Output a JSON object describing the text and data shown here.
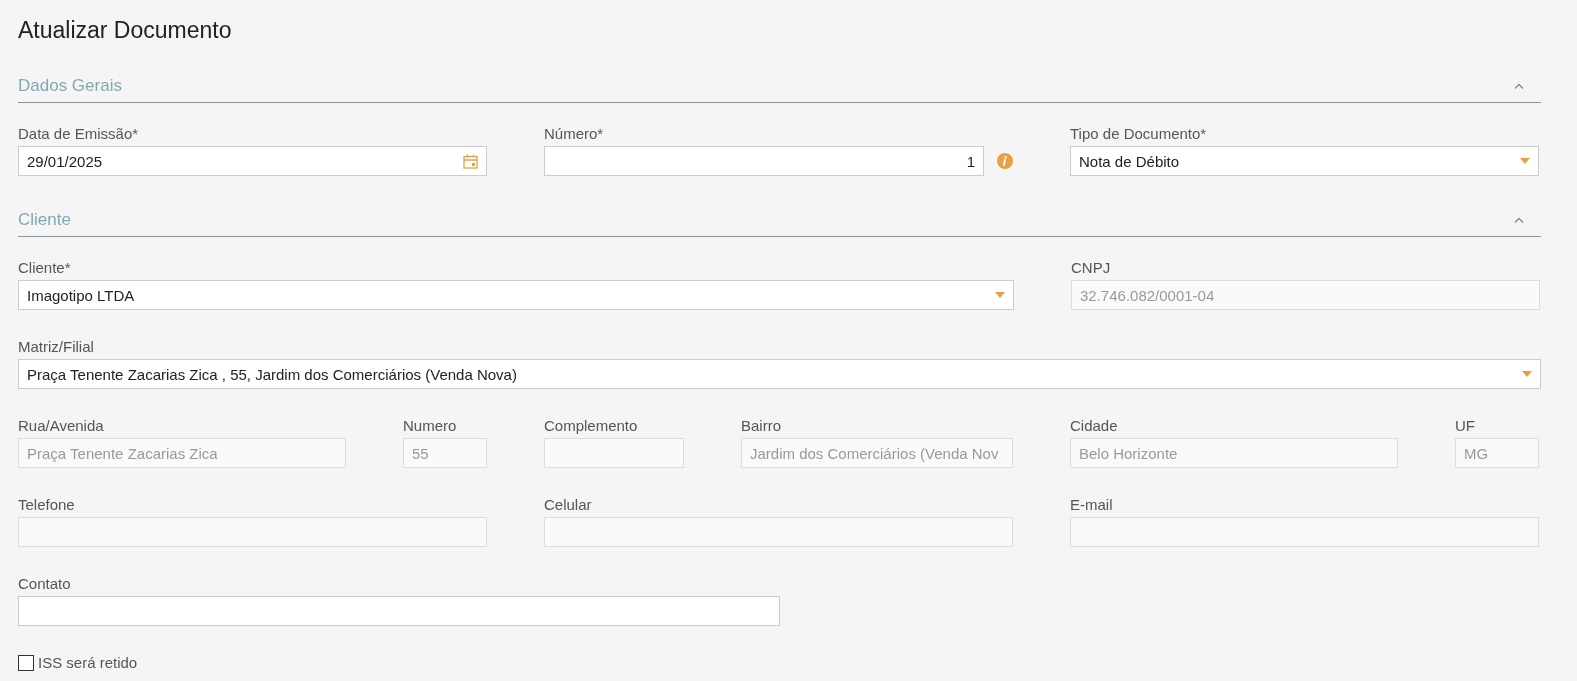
{
  "page_title": "Atualizar Documento",
  "sections": [
    {
      "title": "Dados Gerais",
      "expanded": true,
      "lines": [
        {
          "fields": [
            {
              "label": "Data de Emissão*",
              "value": "29/01/2025",
              "kind": "date"
            },
            {
              "label": "Número*",
              "value": "1",
              "kind": "number",
              "info": true
            },
            {
              "label": "Tipo de Documento*",
              "value": "Nota de Débito",
              "kind": "select"
            }
          ]
        }
      ]
    },
    {
      "title": "Cliente",
      "expanded": true,
      "lines": [
        {
          "fields": [
            {
              "label": "Cliente*",
              "value": "Imagotipo LTDA",
              "kind": "select"
            },
            {
              "label": "CNPJ",
              "value": "32.746.082/0001-04",
              "kind": "readonly"
            }
          ]
        },
        {
          "fields": [
            {
              "label": "Matriz/Filial",
              "value": "Praça Tenente Zacarias Zica , 55, Jardim dos Comerciários (Venda Nova)",
              "kind": "select"
            }
          ]
        },
        {
          "fields": [
            {
              "label": "Rua/Avenida",
              "value": "Praça Tenente Zacarias Zica",
              "kind": "readonly"
            },
            {
              "label": "Numero",
              "value": "55",
              "kind": "readonly"
            },
            {
              "label": "Complemento",
              "kind": "readonly"
            },
            {
              "label": "Bairro",
              "value": "Jardim dos Comerciários (Venda Nov",
              "kind": "readonly"
            },
            {
              "label": "Cidade",
              "value": "Belo Horizonte",
              "kind": "readonly"
            },
            {
              "label": "UF",
              "value": "MG",
              "kind": "readonly"
            }
          ]
        },
        {
          "fields": [
            {
              "label": "Telefone",
              "kind": "readonly"
            },
            {
              "label": "Celular",
              "kind": "readonly"
            },
            {
              "label": "E-mail",
              "kind": "readonly"
            }
          ]
        },
        {
          "fields": [
            {
              "label": "Contato",
              "kind": "text"
            }
          ]
        }
      ]
    }
  ],
  "checkbox": {
    "label": "ISS será retido",
    "checked": false
  }
}
